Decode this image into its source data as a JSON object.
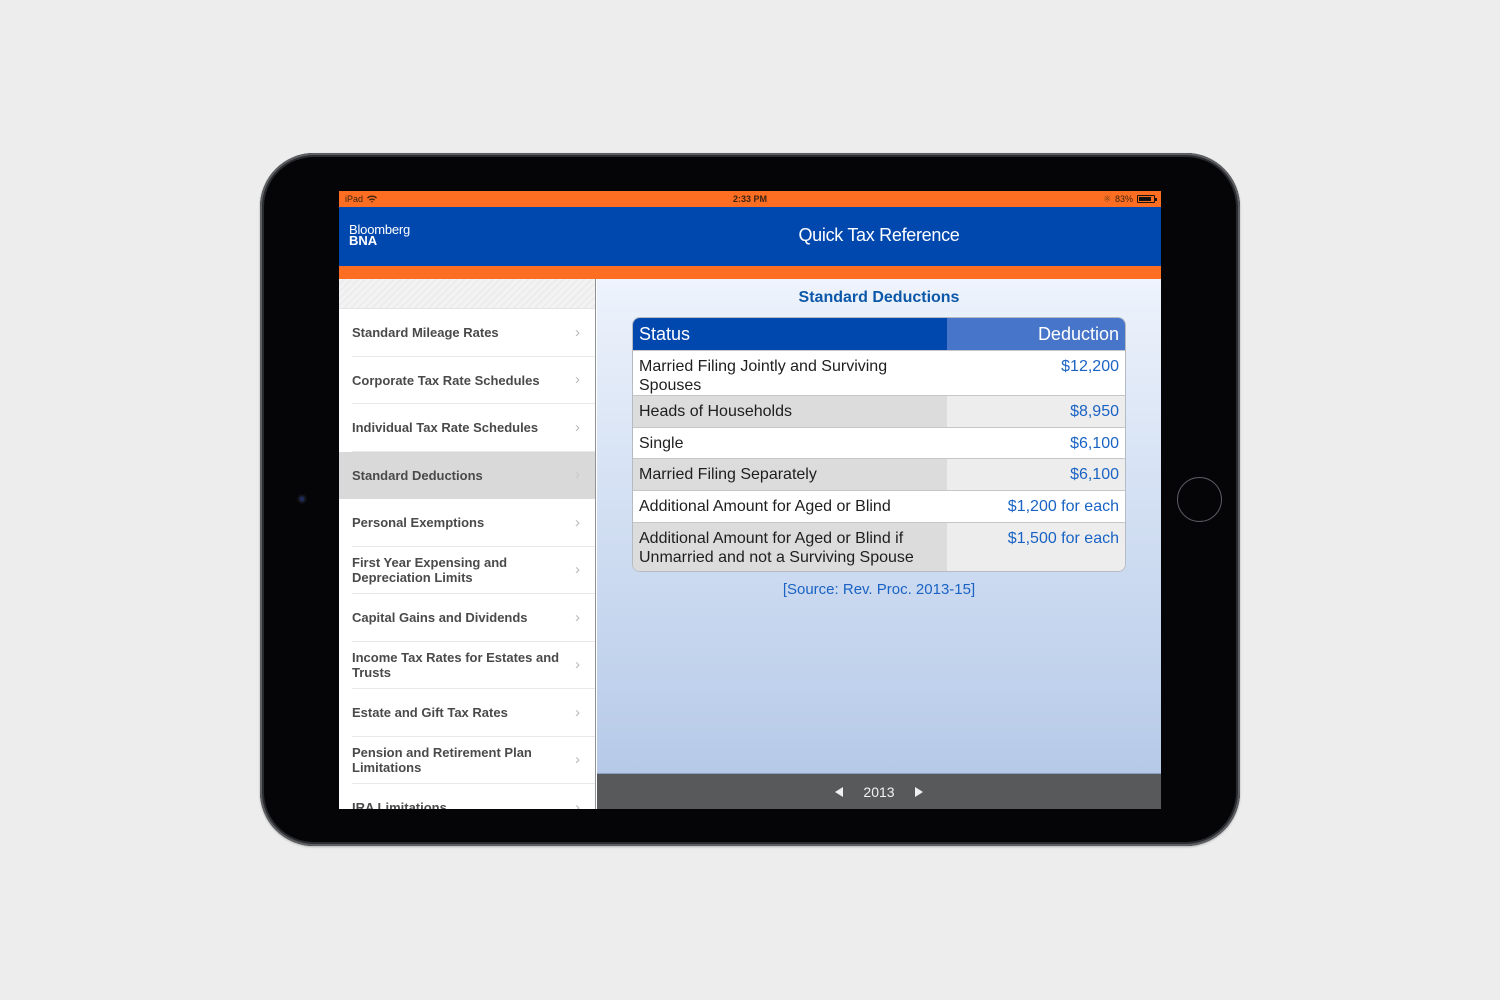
{
  "status_bar": {
    "device": "iPad",
    "time": "2:33 PM",
    "battery": "83%",
    "battery_level": 0.83
  },
  "header": {
    "logo_line1": "Bloomberg",
    "logo_line2": "BNA",
    "title": "Quick Tax Reference"
  },
  "sidebar": {
    "items": [
      {
        "label": "Standard Mileage Rates"
      },
      {
        "label": "Corporate Tax Rate Schedules"
      },
      {
        "label": "Individual Tax Rate Schedules"
      },
      {
        "label": "Standard Deductions",
        "selected": true
      },
      {
        "label": "Personal Exemptions"
      },
      {
        "label": "First Year Expensing and Depreciation Limits"
      },
      {
        "label": "Capital Gains and Dividends"
      },
      {
        "label": "Income Tax Rates for Estates and Trusts"
      },
      {
        "label": "Estate and Gift Tax Rates"
      },
      {
        "label": "Pension and Retirement Plan Limitations"
      },
      {
        "label": "IRA Limitations"
      }
    ]
  },
  "main": {
    "title": "Standard Deductions",
    "table": {
      "headers": [
        "Status",
        "Deduction"
      ],
      "rows": [
        {
          "status": "Married Filing Jointly and Surviving Spouses",
          "deduction": "$12,200"
        },
        {
          "status": "Heads of Households",
          "deduction": "$8,950"
        },
        {
          "status": "Single",
          "deduction": "$6,100"
        },
        {
          "status": "Married Filing Separately",
          "deduction": "$6,100"
        },
        {
          "status": "Additional Amount for Aged or Blind",
          "deduction": "$1,200 for each"
        },
        {
          "status": "Additional Amount for Aged or Blind if Unmarried and not a Surviving Spouse",
          "deduction": "$1,500 for each"
        }
      ]
    },
    "source": "[Source: Rev. Proc. 2013-15]"
  },
  "footer": {
    "year": "2013"
  },
  "colors": {
    "brand_blue": "#0047ae",
    "accent_orange": "#fd6e22",
    "link_blue": "#1a63c4"
  }
}
